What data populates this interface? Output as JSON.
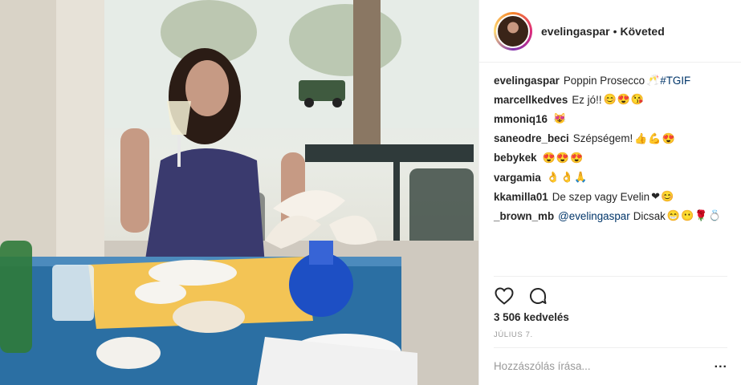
{
  "header": {
    "username": "evelingaspar",
    "separator": "•",
    "follow_state": "Követed"
  },
  "comments": [
    {
      "user": "evelingaspar",
      "text": "Poppin Prosecco",
      "emoji": "🥂",
      "hashtag": "#TGIF"
    },
    {
      "user": "marcellkedves",
      "text": "Ez jó!!",
      "emoji": "😊😍😘"
    },
    {
      "user": "mmoniq16",
      "text": "",
      "emoji": "😻"
    },
    {
      "user": "saneodre_beci",
      "text": "Szépségem!",
      "emoji": "👍💪😍"
    },
    {
      "user": "bebykek",
      "text": "",
      "emoji": "😍😍😍"
    },
    {
      "user": "vargamia",
      "text": "",
      "emoji": "👌👌🙏"
    },
    {
      "user": "kkamilla01",
      "text": "De szep vagy Evelin",
      "emoji": "❤😊"
    },
    {
      "user": "_brown_mb",
      "mention": "@evelingaspar",
      "text": "Dicsak",
      "emoji": "😁😶🌹💍"
    }
  ],
  "actions": {
    "like_icon": "heart-icon",
    "comment_icon": "comment-icon"
  },
  "likes": "3 506 kedvelés",
  "date": "JÚLIUS 7.",
  "add_comment": {
    "placeholder": "Hozzászólás írása...",
    "more_label": "..."
  }
}
